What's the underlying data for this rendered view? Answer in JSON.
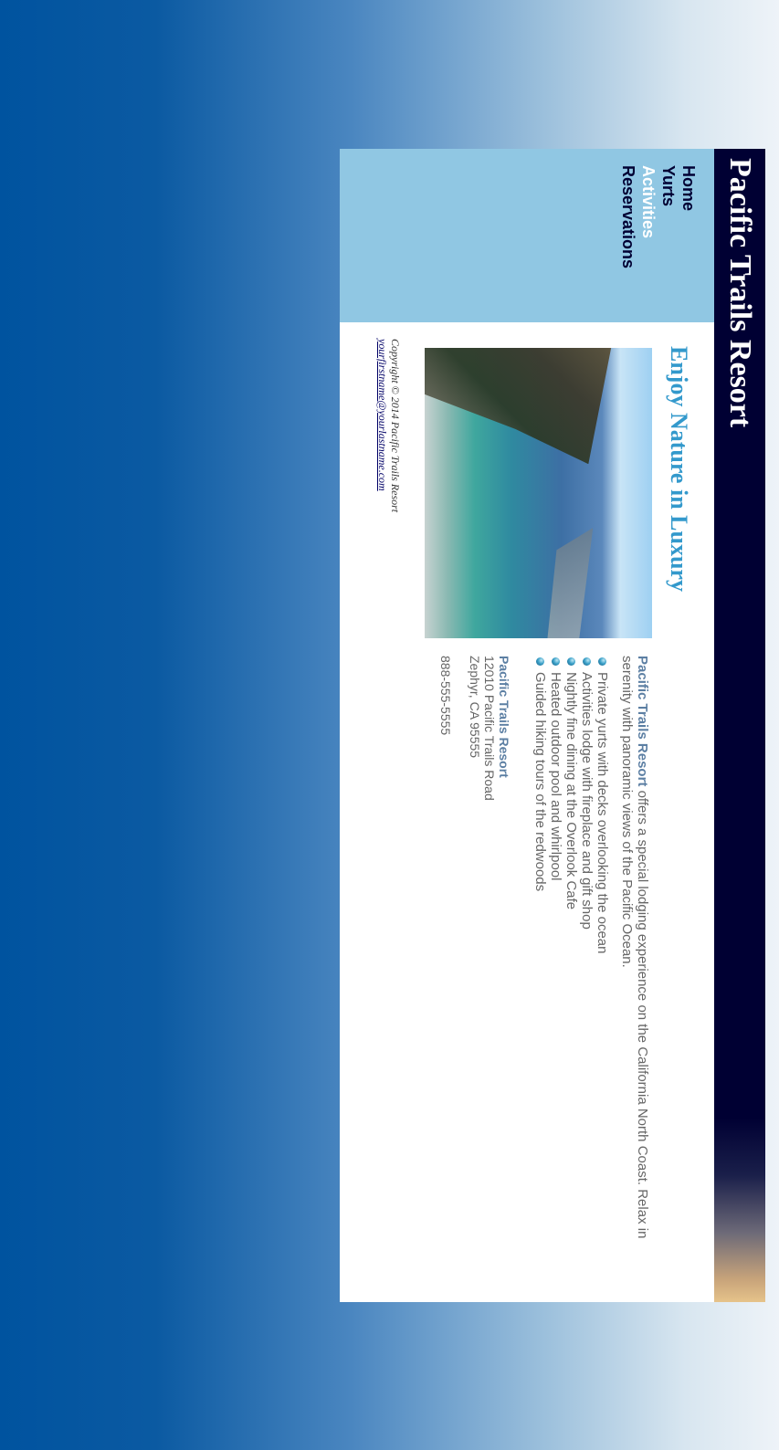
{
  "site": {
    "title": "Pacific Trails Resort"
  },
  "nav": {
    "items": [
      {
        "label": "Home"
      },
      {
        "label": "Yurts"
      },
      {
        "label": "Activities"
      },
      {
        "label": "Reservations"
      }
    ],
    "active_index": 2
  },
  "main": {
    "heading": "Enjoy Nature in Luxury",
    "intro_brand": "Pacific Trails Resort",
    "intro_text": " offers a special lodging experience on the California North Coast. Relax in serenity with panoramic views of the Pacific Ocean.",
    "features": [
      "Private yurts with decks overlooking the ocean",
      "Activities lodge with fireplace and gift shop",
      "Nightly fine dining at the Overlook Cafe",
      "Heated outdoor pool and whirlpool",
      "Guided hiking tours of the redwoods"
    ],
    "contact": {
      "name": "Pacific Trails Resort",
      "street": "12010 Pacific Trails Road",
      "city": "Zephyr, CA 95555",
      "phone": "888-555-5555"
    }
  },
  "footer": {
    "copyright": "Copyright © 2014 Pacific Trails Resort",
    "email": "yourfirstname@yourlastname.com"
  },
  "colors": {
    "header_bg": "#000033",
    "nav_bg": "#90c7e3",
    "heading": "#3399cc",
    "active_nav": "#ffffff"
  }
}
